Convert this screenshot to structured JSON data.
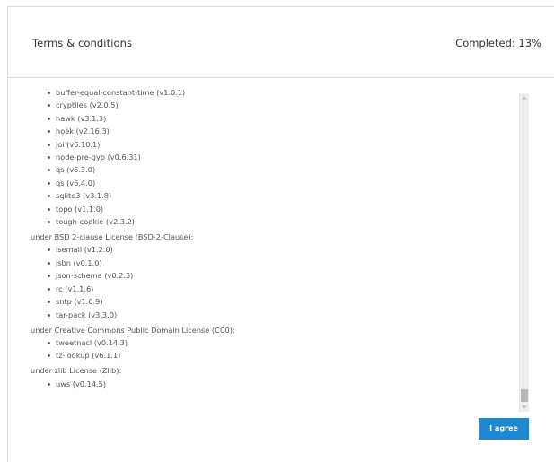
{
  "dialog": {
    "title": "Terms & conditions",
    "progress_label": "Completed: 13%",
    "progress_percent": 13,
    "scroll_position_fraction": 0.97
  },
  "license_groups": [
    {
      "heading": "",
      "items": [
        "buffer-equal-constant-time (v1.0.1)",
        "cryptiles (v2.0.5)",
        "hawk (v3.1.3)",
        "hoek (v2.16.3)",
        "joi (v6.10.1)",
        "node-pre-gyp (v0.6.31)",
        "qs (v6.3.0)",
        "qs (v6.4.0)",
        "sqlite3 (v3.1.8)",
        "topo (v1.1.0)",
        "tough-cookie (v2.3.2)"
      ]
    },
    {
      "heading": "under BSD 2-clause License (BSD-2-Clause):",
      "items": [
        "isemail (v1.2.0)",
        "jsbn (v0.1.0)",
        "json-schema (v0.2.3)",
        "rc (v1.1.6)",
        "sntp (v1.0.9)",
        "tar-pack (v3.3.0)"
      ]
    },
    {
      "heading": "under Creative Commons Public Domain License (CC0):",
      "items": [
        "tweetnacl (v0.14.3)",
        "tz-lookup (v6.1.1)"
      ]
    },
    {
      "heading": "under zlib License (Zlib):",
      "items": [
        "uws (v0.14.5)"
      ]
    }
  ],
  "actions": {
    "agree_label": "I agree"
  },
  "colors": {
    "primary_button": "#1e88d0",
    "divider": "#d9d9d9"
  }
}
